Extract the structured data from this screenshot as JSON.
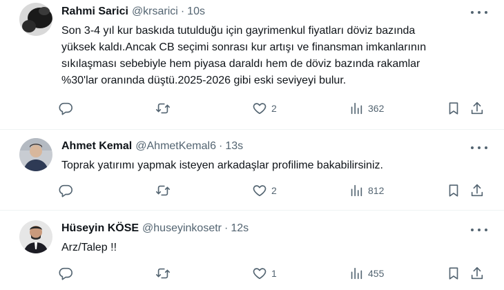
{
  "tweets": [
    {
      "name": "Rahmi Sarici",
      "handle": "@krsarici",
      "time": "10s",
      "text_lines": [
        "Son 3-4 yıl kur baskıda tutulduğu için gayrimenkul fiyatları döviz bazında",
        "yüksek kaldı.Ancak CB seçimi sonrası kur artışı ve finansman imkanlarının",
        "sıkılaşması sebebiyle hem piyasa daraldı hem de döviz bazında rakamlar",
        "%30'lar oranında düştü.2025-2026 gibi eski seviyeyi bulur."
      ],
      "likes": "2",
      "views": "362"
    },
    {
      "name": "Ahmet Kemal",
      "handle": "@AhmetKemal6",
      "time": "13s",
      "text_lines": [
        "Toprak yatırımı yapmak isteyen arkadaşlar profilime bakabilirsiniz."
      ],
      "likes": "2",
      "views": "812"
    },
    {
      "name": "Hüseyin KÖSE",
      "handle": "@huseyinkosetr",
      "time": "12s",
      "text_lines": [
        "Arz/Talep !!"
      ],
      "likes": "1",
      "views": "455"
    }
  ],
  "separator": "·",
  "icons": {
    "reply": "comment-bubble-icon",
    "retweet": "retweet-icon",
    "like": "heart-icon",
    "views": "bar-chart-icon",
    "bookmark": "bookmark-icon",
    "share": "share-upload-icon",
    "more": "ellipsis-icon"
  },
  "colors": {
    "text": "#0f1419",
    "secondary": "#536471",
    "divider": "#eff3f4",
    "background": "#ffffff"
  }
}
